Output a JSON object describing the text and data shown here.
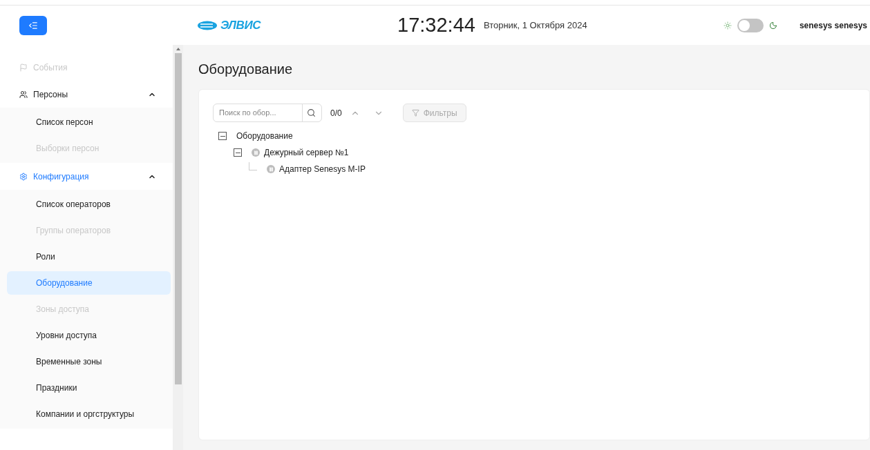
{
  "header": {
    "logo": "ЭЛВИС",
    "time": "17:32:44",
    "date": "Вторник, 1 Октября 2024",
    "dark_mode": false,
    "user": "senesys senesys"
  },
  "sidebar": {
    "items": [
      {
        "label": "События",
        "disabled": true,
        "expanded": false,
        "selected": false
      },
      {
        "label": "Персоны",
        "disabled": false,
        "expanded": true,
        "selected": false,
        "children": [
          {
            "label": "Список персон",
            "disabled": false,
            "selected": false
          },
          {
            "label": "Выборки персон",
            "disabled": true,
            "selected": false
          }
        ]
      },
      {
        "label": "Конфигурация",
        "disabled": false,
        "expanded": true,
        "selected": true,
        "children": [
          {
            "label": "Список операторов",
            "disabled": false,
            "selected": false
          },
          {
            "label": "Группы операторов",
            "disabled": true,
            "selected": false
          },
          {
            "label": "Роли",
            "disabled": false,
            "selected": false
          },
          {
            "label": "Оборудование",
            "disabled": false,
            "selected": true
          },
          {
            "label": "Зоны доступа",
            "disabled": true,
            "selected": false
          },
          {
            "label": "Уровни доступа",
            "disabled": false,
            "selected": false
          },
          {
            "label": "Временные зоны",
            "disabled": false,
            "selected": false
          },
          {
            "label": "Праздники",
            "disabled": false,
            "selected": false
          },
          {
            "label": "Компании и оргструктуры",
            "disabled": false,
            "selected": false
          }
        ]
      }
    ]
  },
  "page": {
    "title": "Оборудование",
    "search": {
      "placeholder": "Поиск по обор..."
    },
    "counter": "0/0",
    "filter_button": {
      "label": "Фильтры",
      "disabled": true
    },
    "tree": [
      {
        "label": "Оборудование",
        "expanded": true,
        "status": false,
        "children": [
          {
            "label": "Дежурный сервер №1",
            "expanded": true,
            "status": true,
            "children": [
              {
                "label": "Адаптер Senesys M-IP",
                "status": true
              }
            ]
          }
        ]
      }
    ]
  }
}
